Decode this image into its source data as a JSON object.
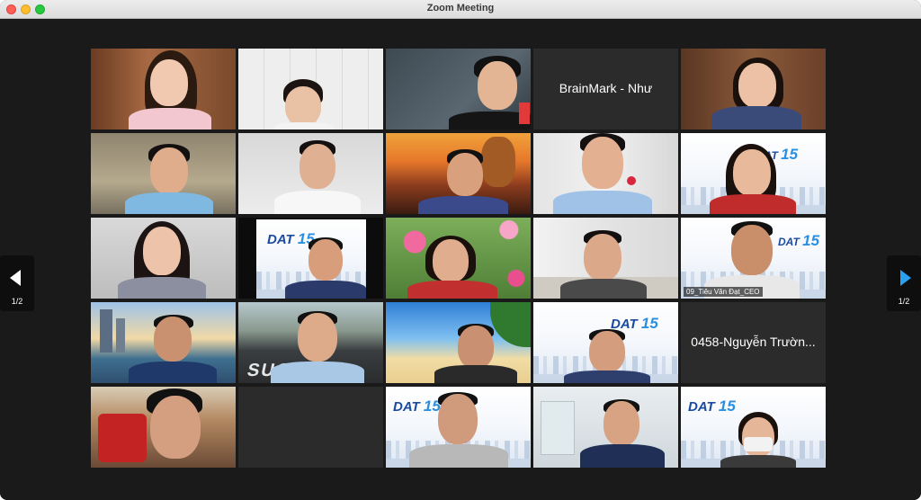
{
  "window": {
    "title": "Zoom Meeting"
  },
  "tiles": {
    "brainmark": "BrainMark - Như",
    "ceo": "09_Tiêu Văn Đạt_CEO",
    "nguyen": "0458-Nguyễn Trườn..."
  },
  "dat_logo": {
    "text": "DAT",
    "number": "15"
  },
  "success_text": "SUCCESS",
  "pager": {
    "label": "1/2",
    "prev_icon": "chevron-left-icon",
    "next_icon": "chevron-right-icon"
  },
  "colors": {
    "active_speaker_border": "#b7e03a",
    "next_arrow": "#2aa0f0"
  }
}
